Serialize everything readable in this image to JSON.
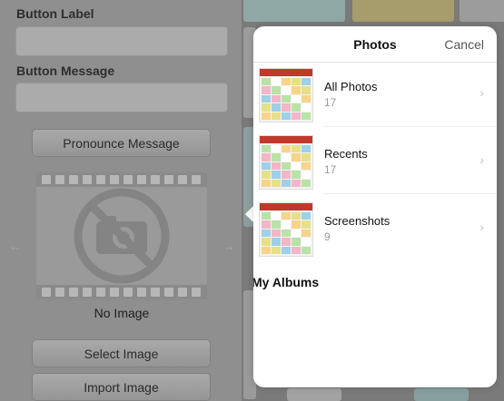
{
  "editor": {
    "button_label_caption": "Button Label",
    "button_label_value": "",
    "button_message_caption": "Button Message",
    "button_message_value": "",
    "pronounce_label": "Pronounce Message",
    "no_image_label": "No Image",
    "select_image_label": "Select Image",
    "import_image_label": "Import Image",
    "left_arrow": "←",
    "right_arrow": "→"
  },
  "popover": {
    "title": "Photos",
    "cancel_label": "Cancel",
    "albums": [
      {
        "title": "All Photos",
        "count": "17"
      },
      {
        "title": "Recents",
        "count": "17"
      },
      {
        "title": "Screenshots",
        "count": "9"
      }
    ],
    "my_albums_label": "My Albums",
    "chevron": "›"
  },
  "colors": {
    "thumb_accent": "#c0392b",
    "dim_overlay": "#8f8f8f"
  }
}
